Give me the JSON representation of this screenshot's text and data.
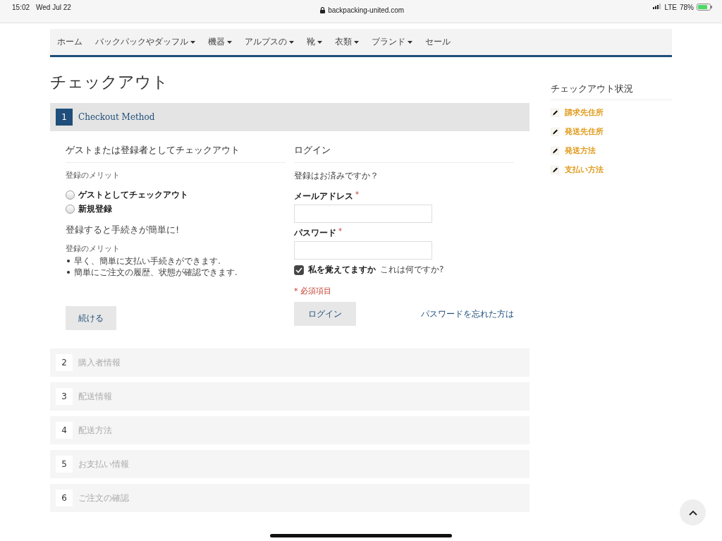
{
  "status_bar": {
    "time": "15:02",
    "date": "Wed Jul 22",
    "url": "backpacking-united.com",
    "network": "LTE",
    "battery": "78%"
  },
  "nav": [
    {
      "label": "ホーム",
      "caret": false
    },
    {
      "label": "バックパックやダッフル",
      "caret": true
    },
    {
      "label": "機器",
      "caret": true
    },
    {
      "label": "アルプスの",
      "caret": true
    },
    {
      "label": "靴",
      "caret": true
    },
    {
      "label": "衣類",
      "caret": true
    },
    {
      "label": "ブランド",
      "caret": true
    },
    {
      "label": "セール",
      "caret": false
    }
  ],
  "page_title": "チェックアウト",
  "steps": [
    {
      "number": "1",
      "label": "Checkout Method",
      "selected": true
    },
    {
      "number": "2",
      "label": "購入者情報",
      "selected": false
    },
    {
      "number": "3",
      "label": "配送情報",
      "selected": false
    },
    {
      "number": "4",
      "label": "配送方法",
      "selected": false
    },
    {
      "number": "5",
      "label": "お支払い情報",
      "selected": false
    },
    {
      "number": "6",
      "label": "ご注文の確認",
      "selected": false
    }
  ],
  "guest": {
    "heading": "ゲストまたは登録者としてチェックアウト",
    "subheading": "登録のメリット",
    "options": [
      {
        "label": "ゲストとしてチェックアウト",
        "selected": false
      },
      {
        "label": "新規登録",
        "selected": false
      }
    ],
    "promo": "登録すると手続きが簡単に!",
    "benefits_title": "登録のメリット",
    "benefits": [
      "早く、簡単に支払い手続きができます.",
      "簡単にご注文の履歴、状態が確認できます."
    ],
    "button": "続ける"
  },
  "login": {
    "heading": "ログイン",
    "question": "登録はお済みですか？",
    "fields": [
      {
        "label": "メールアドレス",
        "required_mark": "*"
      },
      {
        "label": "パスワード",
        "required_mark": "*"
      }
    ],
    "remember": {
      "label": "私を覚えてますか",
      "checked": true,
      "help": "これは何ですか?"
    },
    "required_note": "* 必須項目",
    "button": "ログイン",
    "forgot": "パスワードを忘れた方は"
  },
  "sidebar": {
    "title": "チェックアウト状況",
    "items": [
      "請求先住所",
      "発送先住所",
      "発送方法",
      "支払い方法"
    ]
  }
}
